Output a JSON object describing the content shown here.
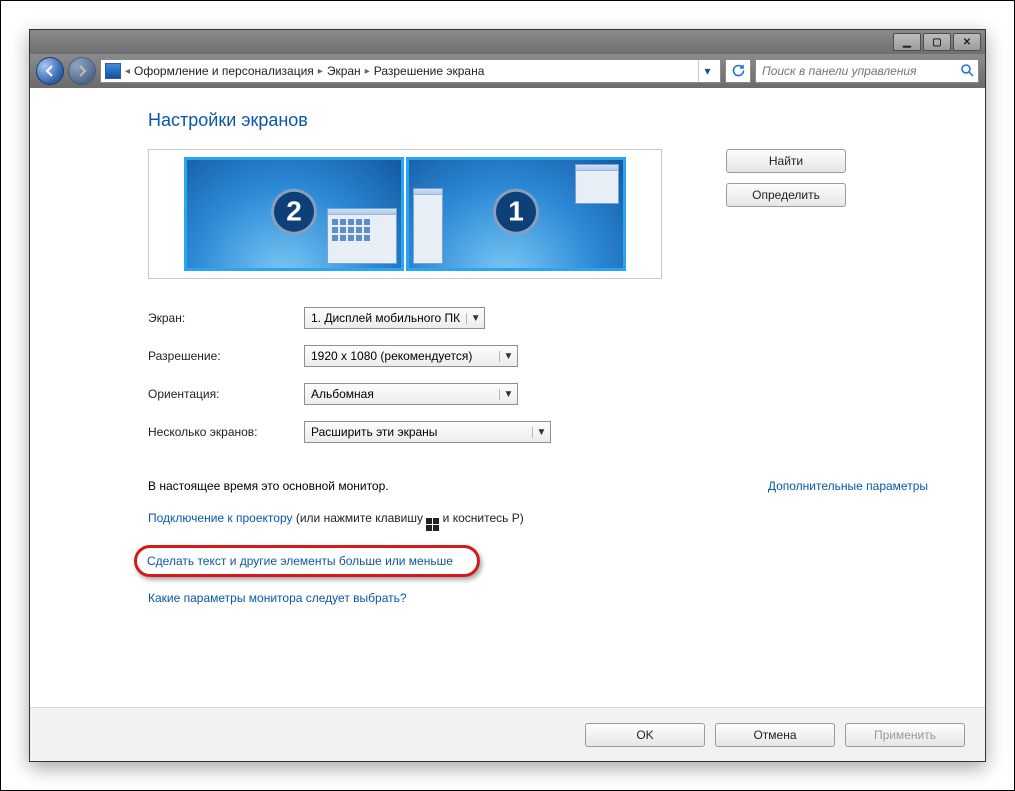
{
  "window": {
    "minimize_glyph": "▁",
    "maximize_glyph": "▢",
    "close_glyph": "✕"
  },
  "nav": {
    "breadcrumb": {
      "level1": "Оформление и персонализация",
      "level2": "Экран",
      "level3": "Разрешение экрана"
    },
    "search_placeholder": "Поиск в панели управления"
  },
  "page": {
    "title": "Настройки экранов",
    "buttons": {
      "detect": "Найти",
      "identify": "Определить"
    },
    "displays": [
      {
        "number": "2"
      },
      {
        "number": "1"
      }
    ],
    "form": {
      "display_label": "Экран:",
      "display_value": "1. Дисплей мобильного ПК",
      "resolution_label": "Разрешение:",
      "resolution_value": "1920 x 1080 (рекомендуется)",
      "orientation_label": "Ориентация:",
      "orientation_value": "Альбомная",
      "multi_label": "Несколько экранов:",
      "multi_value": "Расширить эти экраны"
    },
    "primary_note": "В настоящее время это основной монитор.",
    "advanced_link": "Дополнительные параметры",
    "projector_link": "Подключение к проектору",
    "projector_tail_a": " (или нажмите клавишу ",
    "projector_tail_b": " и коснитесь P)",
    "textsize_link": "Сделать текст и другие элементы больше или меньше",
    "which_link": "Какие параметры монитора следует выбрать?"
  },
  "footer": {
    "ok": "OK",
    "cancel": "Отмена",
    "apply": "Применить"
  }
}
